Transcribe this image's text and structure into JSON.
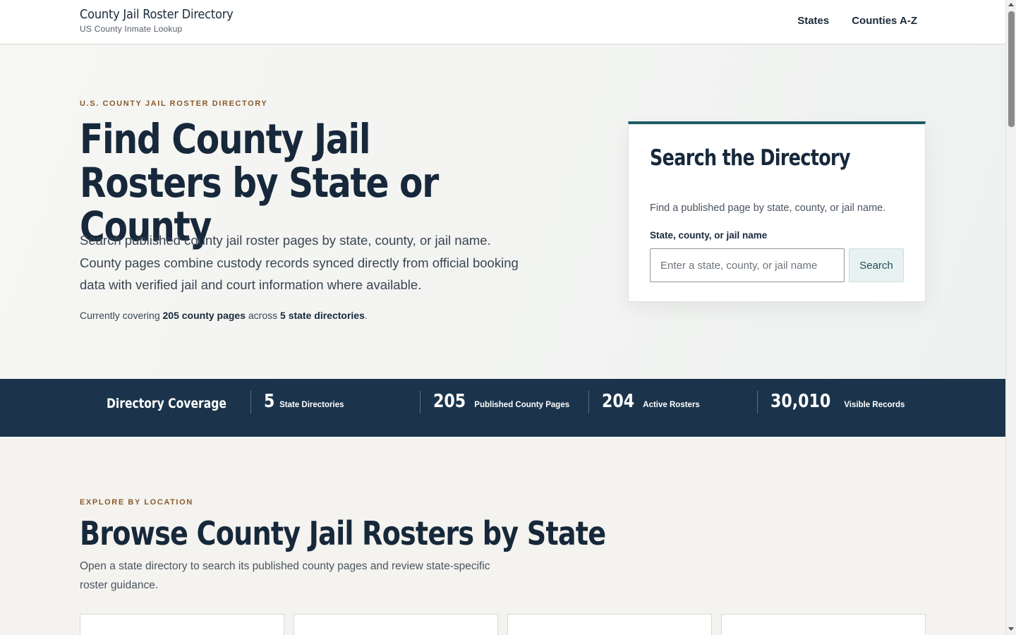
{
  "header": {
    "brand_title": "County Jail Roster Directory",
    "brand_subtitle": "US County Inmate Lookup",
    "nav": [
      {
        "label": "States"
      },
      {
        "label": "Counties A-Z"
      }
    ]
  },
  "hero": {
    "eyebrow": "U.S. COUNTY JAIL ROSTER DIRECTORY",
    "title": "Find County Jail Rosters by State or County",
    "description": "Search published county jail roster pages by state, county, or jail name. County pages combine custody records synced directly from official booking data with verified jail and court information where available.",
    "coverage": {
      "prefix": "Currently covering ",
      "county_pages": "205 county pages",
      "middle": " across ",
      "state_dirs": "5 state directories",
      "suffix": "."
    }
  },
  "search": {
    "title": "Search the Directory",
    "help": "Find a published page by state, county, or jail name.",
    "label": "State, county, or jail name",
    "placeholder": "Enter a state, county, or jail name",
    "button": "Search"
  },
  "stats": {
    "heading": "Directory Coverage",
    "items": [
      {
        "value": "5",
        "label": "State Directories"
      },
      {
        "value": "205",
        "label": "Published County Pages"
      },
      {
        "value": "204",
        "label": "Active Rosters"
      },
      {
        "value": "30,010",
        "label": "Visible Records"
      }
    ]
  },
  "browse": {
    "eyebrow": "EXPLORE BY LOCATION",
    "title": "Browse County Jail Rosters by State",
    "description": "Open a state directory to search its published county pages and review state-specific roster guidance."
  },
  "colors": {
    "navy": "#17283b",
    "stats_band": "#1b344c",
    "accent_teal": "#1e5b63",
    "eyebrow_brown": "#8a5a2b"
  }
}
